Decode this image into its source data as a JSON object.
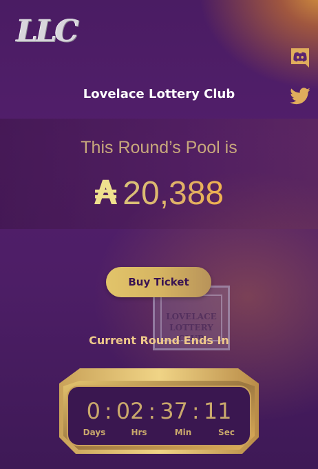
{
  "header": {
    "logo_text": "LLC",
    "site_title": "Lovelace Lottery Club"
  },
  "social": [
    {
      "name": "discord",
      "icon": "discord-icon"
    },
    {
      "name": "twitter",
      "icon": "twitter-icon"
    }
  ],
  "pool": {
    "label": "This Round’s Pool is",
    "currency_symbol": "₳",
    "amount": "20,388"
  },
  "ticket_card": {
    "text": "LOVELACE\nLOTTERY\nCLUB"
  },
  "buy_button_label": "Buy Ticket",
  "round": {
    "label": "Current Round Ends In"
  },
  "countdown": {
    "days": "0",
    "hours": "02",
    "minutes": "37",
    "seconds": "11",
    "separator": ":",
    "days_label": "Days",
    "hours_label": "Hrs",
    "minutes_label": "Min",
    "seconds_label": "Sec"
  },
  "colors": {
    "background": "#4d1e66",
    "gold": "#c9a86c",
    "button": "#d6b562",
    "text_light": "#ffffff"
  }
}
